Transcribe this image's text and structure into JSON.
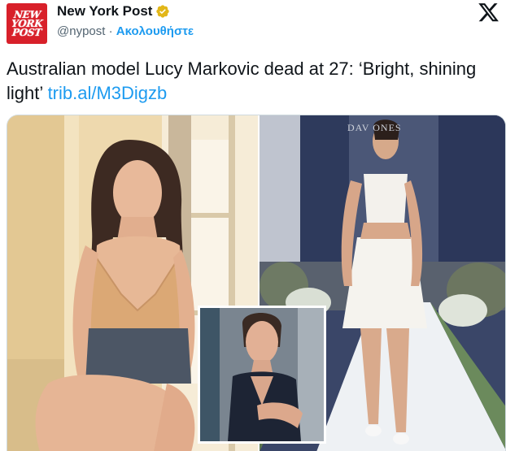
{
  "account": {
    "avatar_text": [
      "NEW",
      "YORK",
      "POST"
    ],
    "name": "New York Post",
    "handle": "@nypost",
    "separator": "·",
    "follow_label": "Ακολουθήστε"
  },
  "tweet": {
    "text": "Australian model Lucy Markovic dead at 27: ‘Bright, shining light’",
    "link": "trib.al/M3Digzb"
  },
  "media": {
    "runway_sign_text": "DAV    ONES"
  },
  "icons": {
    "verified": "verified-badge-icon",
    "x_logo": "x-logo-icon"
  },
  "colors": {
    "link": "#1d9bf0",
    "brand_red": "#d8202a",
    "verified_gold": "#e2b719"
  }
}
